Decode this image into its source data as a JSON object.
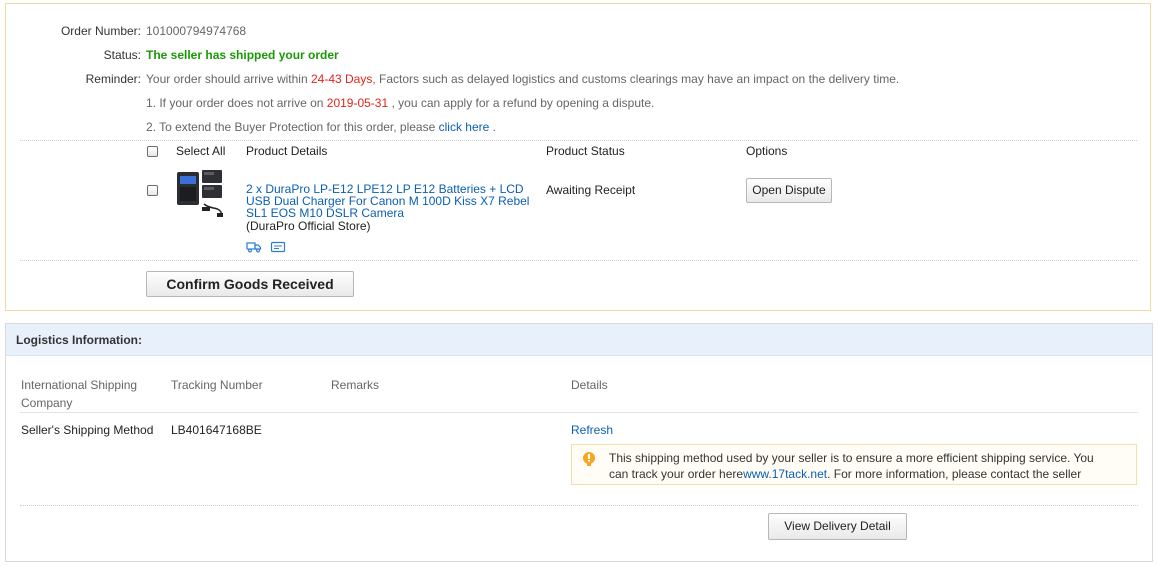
{
  "order": {
    "number_label": "Order Number:",
    "number_value": "101000794974768",
    "status_label": "Status:",
    "status_value": "The seller has shipped your order",
    "reminder_label": "Reminder:",
    "reminder_pre": "Your order should arrive within ",
    "reminder_days": "24-43 Days",
    "reminder_post": ", Factors such as delayed logistics and customs clearings may have an impact on the delivery time.",
    "line1_pre": "1. If your order does not arrive on ",
    "line1_date": "2019-05-31",
    "line1_post": " , you can apply for a refund by opening a dispute.",
    "line2_pre": "2. To extend the Buyer Protection for this order, please ",
    "line2_link": "click here",
    "line2_post": " ."
  },
  "table": {
    "select_all": "Select All",
    "col_product": "Product Details",
    "col_status": "Product Status",
    "col_options": "Options"
  },
  "product": {
    "title_line1": "2 x DuraPro LP-E12 LPE12 LP E12 Batteries + LCD",
    "title_line2": "USB Dual Charger For Canon M 100D Kiss X7 Rebel",
    "title_line3": "SL1 EOS M10 DSLR Camera",
    "store": "(DuraPro Official Store)",
    "status": "Awaiting Receipt",
    "open_dispute": "Open Dispute"
  },
  "confirm_button": "Confirm Goods Received",
  "logistics": {
    "title": "Logistics Information:",
    "col_company_line1": "International Shipping",
    "col_company_line2": "Company",
    "col_tracking": "Tracking Number",
    "col_remarks": "Remarks",
    "col_details": "Details",
    "row_company": "Seller's Shipping Method",
    "row_tracking": "LB401647168BE",
    "refresh": "Refresh",
    "tip_line1": "This shipping method used by your seller is to ensure a more efficient shipping service. You",
    "tip_line2_pre": "can track your order here",
    "tip_link": "www.17tack.net",
    "tip_line2_post": ". For more information, please contact the seller",
    "view_delivery": "View Delivery Detail"
  },
  "colors": {
    "status_green": "#199906",
    "highlight_red": "#e2231a",
    "link_blue": "#0a5fb4",
    "order_border": "#f1d9a0",
    "logistics_header_bg": "#e8f1fb",
    "tip_icon": "#f5a623"
  },
  "icons": [
    "shipping-truck-icon",
    "message-icon",
    "lightbulb-icon"
  ]
}
